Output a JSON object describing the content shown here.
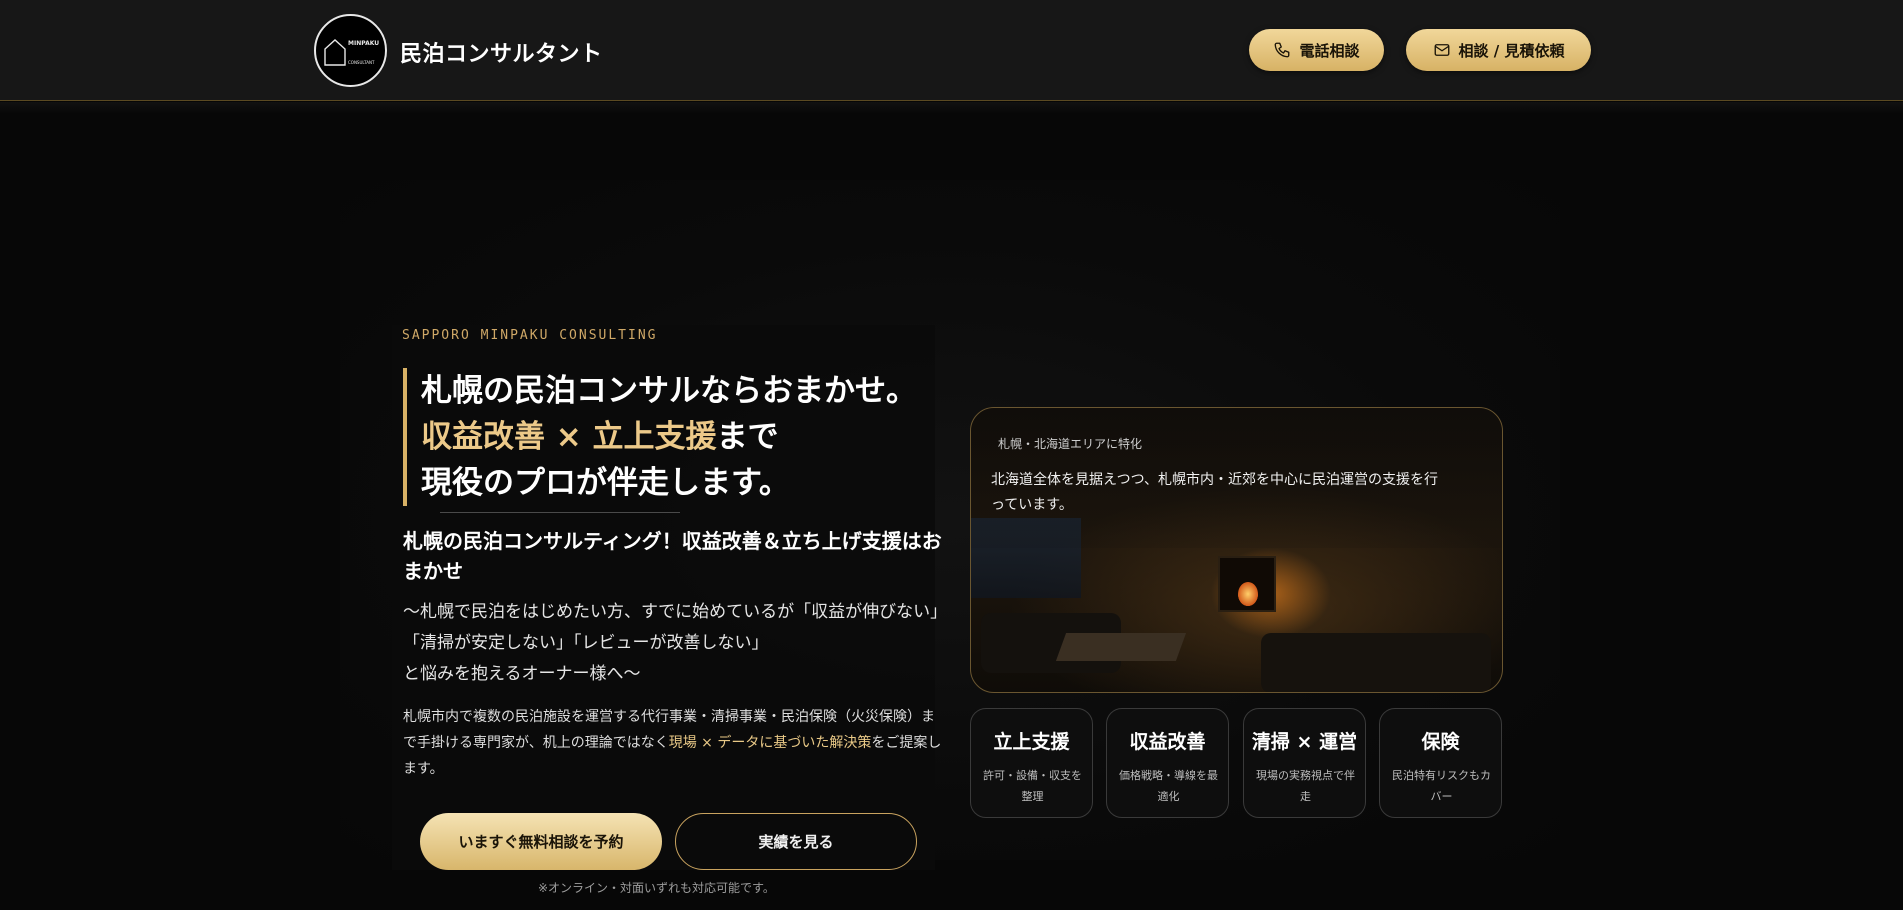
{
  "header": {
    "logo_top": "MINPAKU",
    "logo_bottom": "CONSULTANT",
    "brand": "民泊コンサルタント",
    "phone_label": "電話相談",
    "contact_label": "相談 / 見積依頼"
  },
  "hero": {
    "eyebrow": "SAPPORO MINPAKU CONSULTING",
    "headline_line1": "札幌の民泊コンサルならおまかせ。",
    "headline_gold": "収益改善 × 立上支援",
    "headline_line2_rest": "まで",
    "headline_line3": "現役のプロが伴走します。",
    "subhead": "札幌の民泊コンサルティング！収益改善＆立ち上げ支援はおまかせ",
    "pain_line1": "〜札幌で民泊をはじめたい方、すでに始めているが「収益が伸びない」",
    "pain_line2": "「清掃が安定しない」「レビューが改善しない」",
    "pain_line3": "と悩みを抱えるオーナー様へ〜",
    "desc_part1": "札幌市内で複数の民泊施設を運営する代行事業・清掃事業・民泊保険（火災保険）まで手掛ける専門家が、机上の理論ではなく",
    "desc_gold": "現場 × データに基づいた解決策",
    "desc_part2": "をご提案します。",
    "primary_cta": "いますぐ無料相談を予約",
    "secondary_cta": "実績を見る",
    "note": "※オンライン・対面いずれも対応可能です。"
  },
  "image_card": {
    "tag": "札幌・北海道エリアに特化",
    "text": "北海道全体を見据えつつ、札幌市内・近郊を中心に民泊運営の支援を行っています。"
  },
  "features": [
    {
      "title": "立上支援",
      "desc": "許可・設備・収支を整理"
    },
    {
      "title": "収益改善",
      "desc": "価格戦略・導線を最適化"
    },
    {
      "title": "清掃 × 運営",
      "desc": "現場の実務視点で伴走"
    },
    {
      "title": "保険",
      "desc": "民泊特有リスクもカバー"
    }
  ],
  "colors": {
    "accent_gold": "#d8b165",
    "background": "#070707",
    "header": "#171717"
  }
}
